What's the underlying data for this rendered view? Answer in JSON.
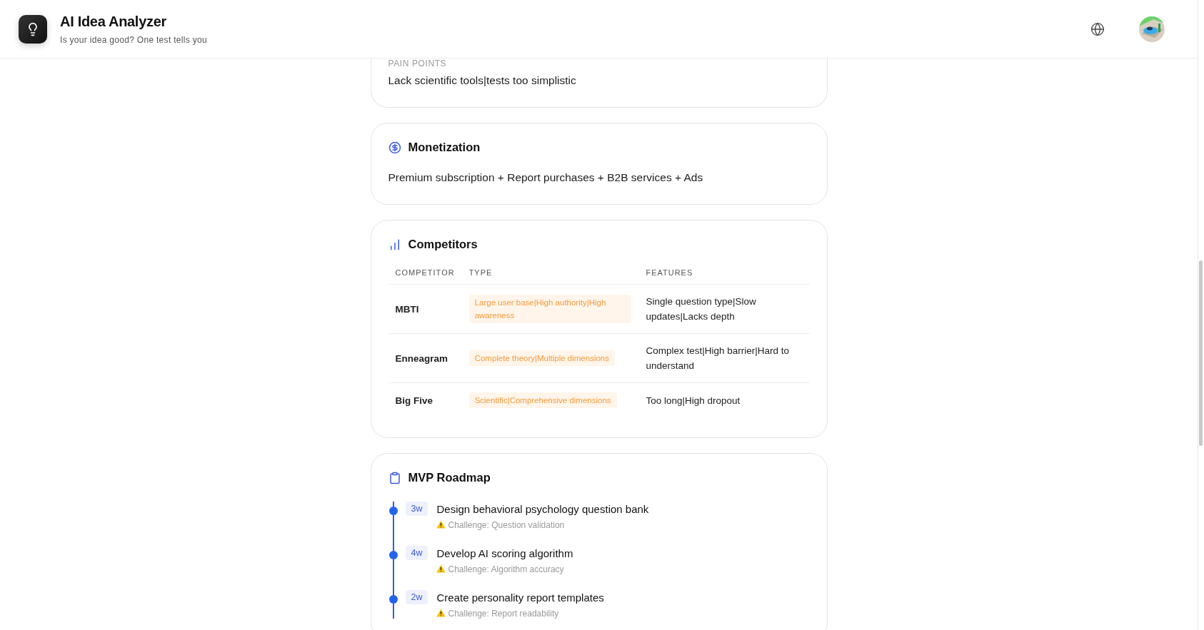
{
  "header": {
    "title": "AI Idea Analyzer",
    "subtitle": "Is your idea good? One test tells you"
  },
  "pain_points": {
    "label": "PAIN POINTS",
    "text": "Lack scientific tools|tests too simplistic"
  },
  "monetization": {
    "title": "Monetization",
    "text": "Premium subscription + Report purchases + B2B services + Ads"
  },
  "competitors": {
    "title": "Competitors",
    "columns": [
      "COMPETITOR",
      "TYPE",
      "FEATURES"
    ],
    "rows": [
      {
        "name": "MBTI",
        "type": "Large user base|High authority|High awareness",
        "features": "Single question type|Slow updates|Lacks depth"
      },
      {
        "name": "Enneagram",
        "type": "Complete theory|Multiple dimensions",
        "features": "Complex test|High barrier|Hard to understand"
      },
      {
        "name": "Big Five",
        "type": "Scientific|Comprehensive dimensions",
        "features": "Too long|High dropout"
      }
    ]
  },
  "roadmap": {
    "title": "MVP Roadmap",
    "steps": [
      {
        "duration": "3w",
        "task": "Design behavioral psychology question bank",
        "challenge": "Challenge: Question validation"
      },
      {
        "duration": "4w",
        "task": "Develop AI scoring algorithm",
        "challenge": "Challenge: Algorithm accuracy"
      },
      {
        "duration": "2w",
        "task": "Create personality report templates",
        "challenge": "Challenge: Report readability"
      }
    ]
  }
}
